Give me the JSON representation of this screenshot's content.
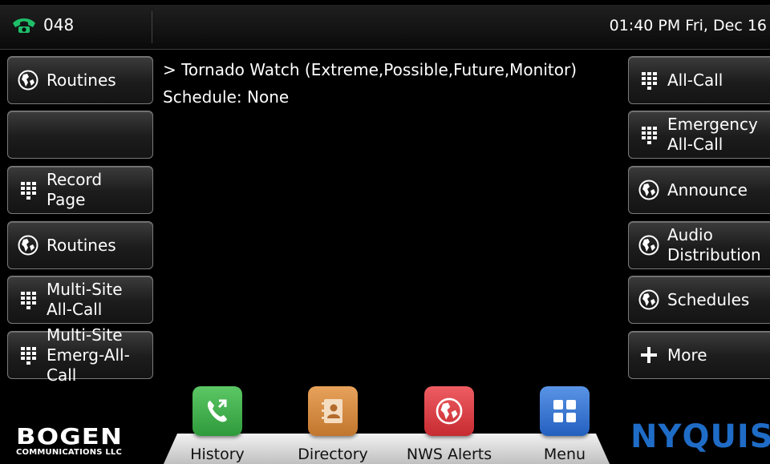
{
  "topbar": {
    "extension": "048",
    "clock": "01:40 PM Fri, Dec 16"
  },
  "status": {
    "line1": "> Tornado Watch (Extreme,Possible,Future,Monitor)",
    "line2": "Schedule: None"
  },
  "left_buttons": [
    {
      "label": "Routines",
      "icon": "globe-icon"
    },
    {
      "label": "",
      "icon": ""
    },
    {
      "label": "Record\nPage",
      "icon": "keypad-icon"
    },
    {
      "label": "Routines",
      "icon": "globe-icon"
    },
    {
      "label": "Multi-Site\nAll-Call",
      "icon": "keypad-icon"
    },
    {
      "label": "Multi-Site\nEmerg-All-Call",
      "icon": "keypad-icon"
    }
  ],
  "right_buttons": [
    {
      "label": "All-Call",
      "icon": "keypad-icon"
    },
    {
      "label": "Emergency\nAll-Call",
      "icon": "keypad-icon"
    },
    {
      "label": "Announce",
      "icon": "globe-icon"
    },
    {
      "label": "Audio\nDistribution",
      "icon": "globe-icon"
    },
    {
      "label": "Schedules",
      "icon": "globe-icon"
    },
    {
      "label": "More",
      "icon": "plus-icon"
    }
  ],
  "dock": [
    {
      "label": "History",
      "icon": "call-history-icon",
      "color": "#3fae49"
    },
    {
      "label": "Directory",
      "icon": "address-book-icon",
      "color": "#d7893a"
    },
    {
      "label": "NWS Alerts",
      "icon": "globe-alert-icon",
      "color": "#d93a3f"
    },
    {
      "label": "Menu",
      "icon": "grid-menu-icon",
      "color": "#2f6fcf"
    }
  ],
  "logos": {
    "left_word": "BOGEN",
    "left_sub": "COMMUNICATIONS LLC",
    "right_word": "NYQUIST"
  },
  "colors": {
    "phone_icon": "#1fbf6a",
    "nyquist_blue": "#1f6cc7"
  }
}
